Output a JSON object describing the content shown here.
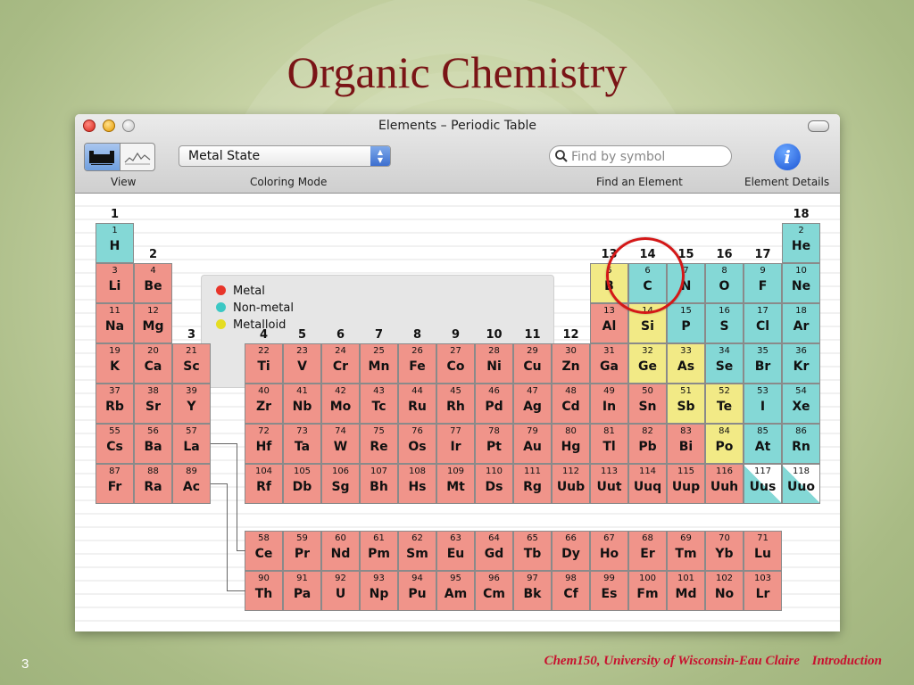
{
  "slide": {
    "title": "Organic Chemistry",
    "number": "3",
    "footer_course": "Chem150, University of Wisconsin-Eau Claire",
    "footer_topic": "Introduction"
  },
  "window": {
    "title": "Elements – Periodic Table",
    "toolbar": {
      "view_label": "View",
      "coloring_label": "Coloring Mode",
      "coloring_value": "Metal State",
      "find_label": "Find an Element",
      "search_placeholder": "Find by symbol",
      "details_label": "Element Details"
    },
    "legend": [
      {
        "label": "Metal",
        "color": "#e8352a"
      },
      {
        "label": "Non-metal",
        "color": "#3cc8c4"
      },
      {
        "label": "Metalloid",
        "color": "#e5dd22"
      }
    ],
    "type_colors": {
      "metal": "#f0948a",
      "nonmetal": "#84d8d6",
      "metalloid": "#f2ea86",
      "unknown": "#ffffff"
    },
    "group_labels": [
      "1",
      "2",
      "3",
      "4",
      "5",
      "6",
      "7",
      "8",
      "9",
      "10",
      "11",
      "12",
      "13",
      "14",
      "15",
      "16",
      "17",
      "18"
    ],
    "elements": [
      {
        "z": "1",
        "s": "H",
        "g": 1,
        "p": 1,
        "t": "nonmetal"
      },
      {
        "z": "2",
        "s": "He",
        "g": 18,
        "p": 1,
        "t": "nonmetal"
      },
      {
        "z": "3",
        "s": "Li",
        "g": 1,
        "p": 2,
        "t": "metal"
      },
      {
        "z": "4",
        "s": "Be",
        "g": 2,
        "p": 2,
        "t": "metal"
      },
      {
        "z": "5",
        "s": "B",
        "g": 13,
        "p": 2,
        "t": "metalloid"
      },
      {
        "z": "6",
        "s": "C",
        "g": 14,
        "p": 2,
        "t": "nonmetal"
      },
      {
        "z": "7",
        "s": "N",
        "g": 15,
        "p": 2,
        "t": "nonmetal"
      },
      {
        "z": "8",
        "s": "O",
        "g": 16,
        "p": 2,
        "t": "nonmetal"
      },
      {
        "z": "9",
        "s": "F",
        "g": 17,
        "p": 2,
        "t": "nonmetal"
      },
      {
        "z": "10",
        "s": "Ne",
        "g": 18,
        "p": 2,
        "t": "nonmetal"
      },
      {
        "z": "11",
        "s": "Na",
        "g": 1,
        "p": 3,
        "t": "metal"
      },
      {
        "z": "12",
        "s": "Mg",
        "g": 2,
        "p": 3,
        "t": "metal"
      },
      {
        "z": "13",
        "s": "Al",
        "g": 13,
        "p": 3,
        "t": "metal"
      },
      {
        "z": "14",
        "s": "Si",
        "g": 14,
        "p": 3,
        "t": "metalloid"
      },
      {
        "z": "15",
        "s": "P",
        "g": 15,
        "p": 3,
        "t": "nonmetal"
      },
      {
        "z": "16",
        "s": "S",
        "g": 16,
        "p": 3,
        "t": "nonmetal"
      },
      {
        "z": "17",
        "s": "Cl",
        "g": 17,
        "p": 3,
        "t": "nonmetal"
      },
      {
        "z": "18",
        "s": "Ar",
        "g": 18,
        "p": 3,
        "t": "nonmetal"
      },
      {
        "z": "19",
        "s": "K",
        "g": 1,
        "p": 4,
        "t": "metal"
      },
      {
        "z": "20",
        "s": "Ca",
        "g": 2,
        "p": 4,
        "t": "metal"
      },
      {
        "z": "21",
        "s": "Sc",
        "g": 3,
        "p": 4,
        "t": "metal"
      },
      {
        "z": "22",
        "s": "Ti",
        "g": 4,
        "p": 4,
        "t": "metal"
      },
      {
        "z": "23",
        "s": "V",
        "g": 5,
        "p": 4,
        "t": "metal"
      },
      {
        "z": "24",
        "s": "Cr",
        "g": 6,
        "p": 4,
        "t": "metal"
      },
      {
        "z": "25",
        "s": "Mn",
        "g": 7,
        "p": 4,
        "t": "metal"
      },
      {
        "z": "26",
        "s": "Fe",
        "g": 8,
        "p": 4,
        "t": "metal"
      },
      {
        "z": "27",
        "s": "Co",
        "g": 9,
        "p": 4,
        "t": "metal"
      },
      {
        "z": "28",
        "s": "Ni",
        "g": 10,
        "p": 4,
        "t": "metal"
      },
      {
        "z": "29",
        "s": "Cu",
        "g": 11,
        "p": 4,
        "t": "metal"
      },
      {
        "z": "30",
        "s": "Zn",
        "g": 12,
        "p": 4,
        "t": "metal"
      },
      {
        "z": "31",
        "s": "Ga",
        "g": 13,
        "p": 4,
        "t": "metal"
      },
      {
        "z": "32",
        "s": "Ge",
        "g": 14,
        "p": 4,
        "t": "metalloid"
      },
      {
        "z": "33",
        "s": "As",
        "g": 15,
        "p": 4,
        "t": "metalloid"
      },
      {
        "z": "34",
        "s": "Se",
        "g": 16,
        "p": 4,
        "t": "nonmetal"
      },
      {
        "z": "35",
        "s": "Br",
        "g": 17,
        "p": 4,
        "t": "nonmetal"
      },
      {
        "z": "36",
        "s": "Kr",
        "g": 18,
        "p": 4,
        "t": "nonmetal"
      },
      {
        "z": "37",
        "s": "Rb",
        "g": 1,
        "p": 5,
        "t": "metal"
      },
      {
        "z": "38",
        "s": "Sr",
        "g": 2,
        "p": 5,
        "t": "metal"
      },
      {
        "z": "39",
        "s": "Y",
        "g": 3,
        "p": 5,
        "t": "metal"
      },
      {
        "z": "40",
        "s": "Zr",
        "g": 4,
        "p": 5,
        "t": "metal"
      },
      {
        "z": "41",
        "s": "Nb",
        "g": 5,
        "p": 5,
        "t": "metal"
      },
      {
        "z": "42",
        "s": "Mo",
        "g": 6,
        "p": 5,
        "t": "metal"
      },
      {
        "z": "43",
        "s": "Tc",
        "g": 7,
        "p": 5,
        "t": "metal"
      },
      {
        "z": "44",
        "s": "Ru",
        "g": 8,
        "p": 5,
        "t": "metal"
      },
      {
        "z": "45",
        "s": "Rh",
        "g": 9,
        "p": 5,
        "t": "metal"
      },
      {
        "z": "46",
        "s": "Pd",
        "g": 10,
        "p": 5,
        "t": "metal"
      },
      {
        "z": "47",
        "s": "Ag",
        "g": 11,
        "p": 5,
        "t": "metal"
      },
      {
        "z": "48",
        "s": "Cd",
        "g": 12,
        "p": 5,
        "t": "metal"
      },
      {
        "z": "49",
        "s": "In",
        "g": 13,
        "p": 5,
        "t": "metal"
      },
      {
        "z": "50",
        "s": "Sn",
        "g": 14,
        "p": 5,
        "t": "metal"
      },
      {
        "z": "51",
        "s": "Sb",
        "g": 15,
        "p": 5,
        "t": "metalloid"
      },
      {
        "z": "52",
        "s": "Te",
        "g": 16,
        "p": 5,
        "t": "metalloid"
      },
      {
        "z": "53",
        "s": "I",
        "g": 17,
        "p": 5,
        "t": "nonmetal"
      },
      {
        "z": "54",
        "s": "Xe",
        "g": 18,
        "p": 5,
        "t": "nonmetal"
      },
      {
        "z": "55",
        "s": "Cs",
        "g": 1,
        "p": 6,
        "t": "metal"
      },
      {
        "z": "56",
        "s": "Ba",
        "g": 2,
        "p": 6,
        "t": "metal"
      },
      {
        "z": "57",
        "s": "La",
        "g": 3,
        "p": 6,
        "t": "metal"
      },
      {
        "z": "72",
        "s": "Hf",
        "g": 4,
        "p": 6,
        "t": "metal"
      },
      {
        "z": "73",
        "s": "Ta",
        "g": 5,
        "p": 6,
        "t": "metal"
      },
      {
        "z": "74",
        "s": "W",
        "g": 6,
        "p": 6,
        "t": "metal"
      },
      {
        "z": "75",
        "s": "Re",
        "g": 7,
        "p": 6,
        "t": "metal"
      },
      {
        "z": "76",
        "s": "Os",
        "g": 8,
        "p": 6,
        "t": "metal"
      },
      {
        "z": "77",
        "s": "Ir",
        "g": 9,
        "p": 6,
        "t": "metal"
      },
      {
        "z": "78",
        "s": "Pt",
        "g": 10,
        "p": 6,
        "t": "metal"
      },
      {
        "z": "79",
        "s": "Au",
        "g": 11,
        "p": 6,
        "t": "metal"
      },
      {
        "z": "80",
        "s": "Hg",
        "g": 12,
        "p": 6,
        "t": "metal"
      },
      {
        "z": "81",
        "s": "Tl",
        "g": 13,
        "p": 6,
        "t": "metal"
      },
      {
        "z": "82",
        "s": "Pb",
        "g": 14,
        "p": 6,
        "t": "metal"
      },
      {
        "z": "83",
        "s": "Bi",
        "g": 15,
        "p": 6,
        "t": "metal"
      },
      {
        "z": "84",
        "s": "Po",
        "g": 16,
        "p": 6,
        "t": "metalloid"
      },
      {
        "z": "85",
        "s": "At",
        "g": 17,
        "p": 6,
        "t": "nonmetal"
      },
      {
        "z": "86",
        "s": "Rn",
        "g": 18,
        "p": 6,
        "t": "nonmetal"
      },
      {
        "z": "87",
        "s": "Fr",
        "g": 1,
        "p": 7,
        "t": "metal"
      },
      {
        "z": "88",
        "s": "Ra",
        "g": 2,
        "p": 7,
        "t": "metal"
      },
      {
        "z": "89",
        "s": "Ac",
        "g": 3,
        "p": 7,
        "t": "metal"
      },
      {
        "z": "104",
        "s": "Rf",
        "g": 4,
        "p": 7,
        "t": "metal"
      },
      {
        "z": "105",
        "s": "Db",
        "g": 5,
        "p": 7,
        "t": "metal"
      },
      {
        "z": "106",
        "s": "Sg",
        "g": 6,
        "p": 7,
        "t": "metal"
      },
      {
        "z": "107",
        "s": "Bh",
        "g": 7,
        "p": 7,
        "t": "metal"
      },
      {
        "z": "108",
        "s": "Hs",
        "g": 8,
        "p": 7,
        "t": "metal"
      },
      {
        "z": "109",
        "s": "Mt",
        "g": 9,
        "p": 7,
        "t": "metal"
      },
      {
        "z": "110",
        "s": "Ds",
        "g": 10,
        "p": 7,
        "t": "metal"
      },
      {
        "z": "111",
        "s": "Rg",
        "g": 11,
        "p": 7,
        "t": "metal"
      },
      {
        "z": "112",
        "s": "Uub",
        "g": 12,
        "p": 7,
        "t": "metal"
      },
      {
        "z": "113",
        "s": "Uut",
        "g": 13,
        "p": 7,
        "t": "metal"
      },
      {
        "z": "114",
        "s": "Uuq",
        "g": 14,
        "p": 7,
        "t": "metal"
      },
      {
        "z": "115",
        "s": "Uup",
        "g": 15,
        "p": 7,
        "t": "metal"
      },
      {
        "z": "116",
        "s": "Uuh",
        "g": 16,
        "p": 7,
        "t": "metal"
      },
      {
        "z": "117",
        "s": "Uus",
        "g": 17,
        "p": 7,
        "t": "partial"
      },
      {
        "z": "118",
        "s": "Uuo",
        "g": 18,
        "p": 7,
        "t": "partial"
      }
    ],
    "lanthanides": [
      {
        "z": "58",
        "s": "Ce"
      },
      {
        "z": "59",
        "s": "Pr"
      },
      {
        "z": "60",
        "s": "Nd"
      },
      {
        "z": "61",
        "s": "Pm"
      },
      {
        "z": "62",
        "s": "Sm"
      },
      {
        "z": "63",
        "s": "Eu"
      },
      {
        "z": "64",
        "s": "Gd"
      },
      {
        "z": "65",
        "s": "Tb"
      },
      {
        "z": "66",
        "s": "Dy"
      },
      {
        "z": "67",
        "s": "Ho"
      },
      {
        "z": "68",
        "s": "Er"
      },
      {
        "z": "69",
        "s": "Tm"
      },
      {
        "z": "70",
        "s": "Yb"
      },
      {
        "z": "71",
        "s": "Lu"
      }
    ],
    "actinides": [
      {
        "z": "90",
        "s": "Th"
      },
      {
        "z": "91",
        "s": "Pa"
      },
      {
        "z": "92",
        "s": "U"
      },
      {
        "z": "93",
        "s": "Np"
      },
      {
        "z": "94",
        "s": "Pu"
      },
      {
        "z": "95",
        "s": "Am"
      },
      {
        "z": "96",
        "s": "Cm"
      },
      {
        "z": "97",
        "s": "Bk"
      },
      {
        "z": "98",
        "s": "Cf"
      },
      {
        "z": "99",
        "s": "Es"
      },
      {
        "z": "100",
        "s": "Fm"
      },
      {
        "z": "101",
        "s": "Md"
      },
      {
        "z": "102",
        "s": "No"
      },
      {
        "z": "103",
        "s": "Lr"
      }
    ],
    "annotation": {
      "color": "#d41818",
      "circled": [
        "C"
      ]
    }
  }
}
